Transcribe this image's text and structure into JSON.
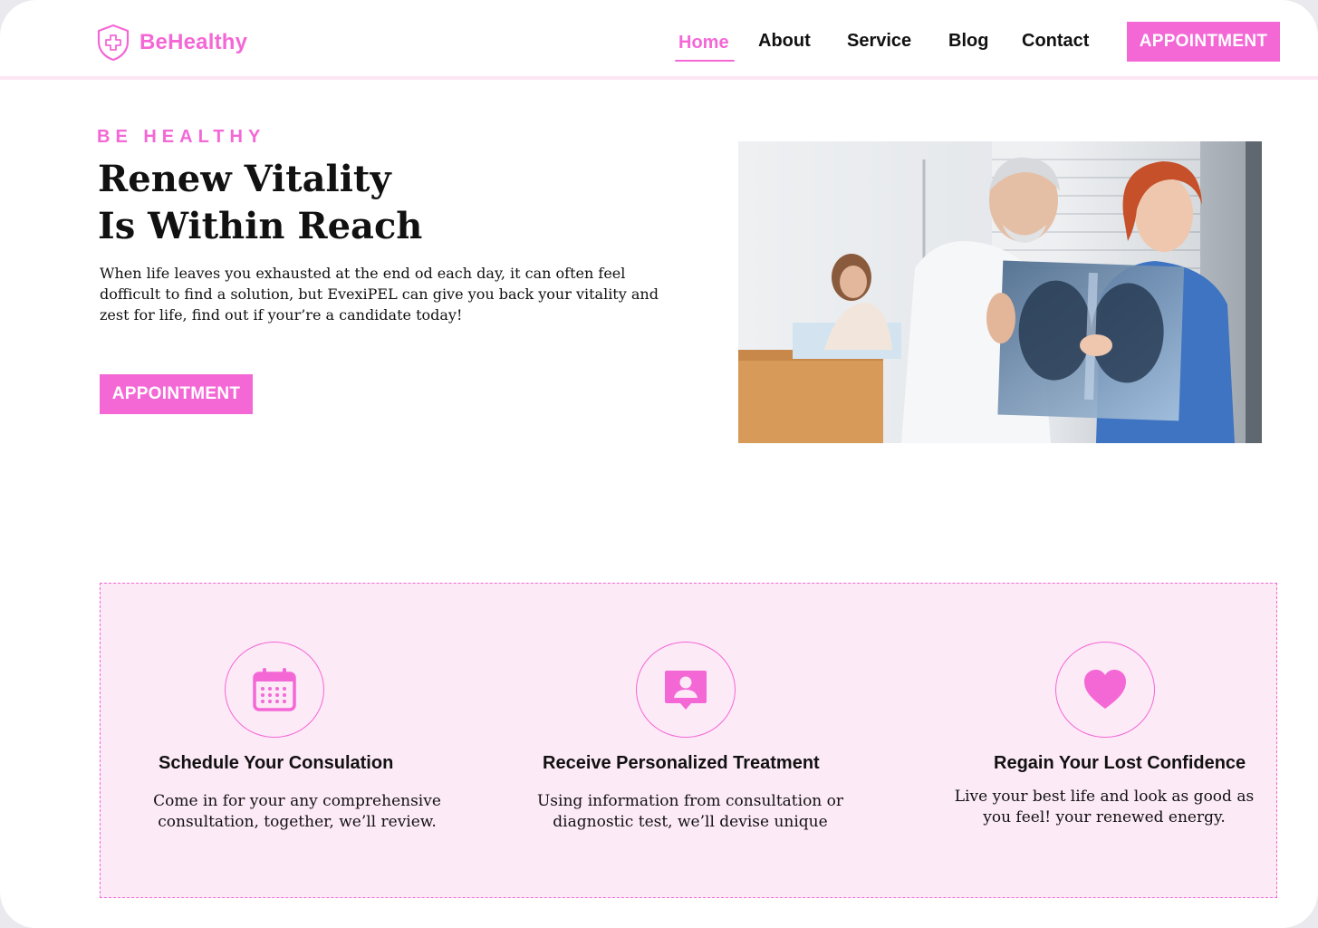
{
  "brand": {
    "name": "BeHealthy",
    "color": "#f468d6"
  },
  "nav": {
    "items": [
      {
        "label": "Home",
        "active": true
      },
      {
        "label": "About",
        "active": false
      },
      {
        "label": "Service",
        "active": false
      },
      {
        "label": "Blog",
        "active": false
      },
      {
        "label": "Contact",
        "active": false
      }
    ],
    "cta_label": "APPOINTMENT"
  },
  "hero": {
    "eyebrow": "BE HEALTHY",
    "title_line1": "Renew Vitality",
    "title_line2": "Is Within Reach",
    "description": "When life leaves you exhausted at the end od each day, it can often feel dofficult to find a solution, but EvexiPEL can give you back your vitality and zest for life, find out if your’re a candidate today!",
    "cta_label": "APPOINTMENT",
    "image": "doctors-reviewing-xray-photo"
  },
  "features": [
    {
      "icon": "calendar-icon",
      "title": "Schedule Your Consulation",
      "description": "Come in for your any comprehensive consultation, together, we’ll review."
    },
    {
      "icon": "user-card-icon",
      "title": "Receive Personalized Treatment",
      "description": "Using information from consultation or diagnostic test, we’ll devise unique"
    },
    {
      "icon": "heart-icon",
      "title": "Regain Your Lost Confidence",
      "description": "Live your best life and look as good as you feel! your renewed energy."
    }
  ]
}
